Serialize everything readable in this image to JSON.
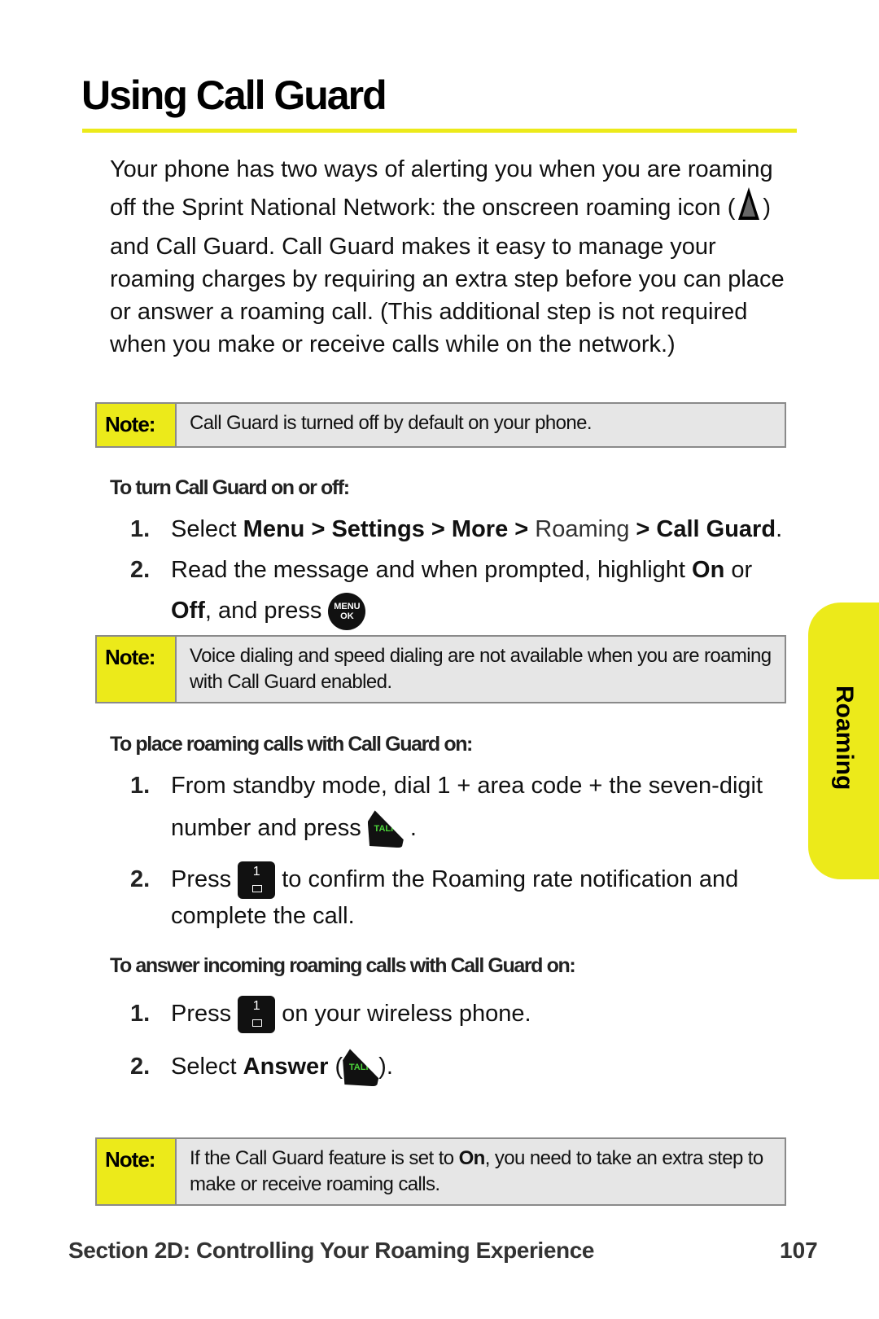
{
  "page": {
    "title": "Using Call Guard",
    "intro": {
      "before_icon": "Your phone has two ways of alerting you when you are roaming off the Sprint National Network: the onscreen roaming icon (",
      "icon": "roaming-icon",
      "after_icon": ") and Call Guard. Call Guard makes it easy to manage your roaming charges by requiring an extra step before you can place or answer a roaming call. (This additional step is not required when you make or receive calls while on the network.)"
    },
    "notes": [
      {
        "label": "Note:",
        "text": "Call Guard is turned off by default on your phone."
      },
      {
        "label": "Note:",
        "text": "Voice dialing and speed dialing are not available when you are roaming with Call Guard enabled."
      },
      {
        "label": "Note:",
        "text_before": "If the Call Guard feature is set to ",
        "bold": "On",
        "text_after": ", you need to take an extra step to make or receive roaming calls."
      }
    ],
    "sections": [
      {
        "heading": "To turn Call Guard on or off:",
        "steps": [
          {
            "num": "1.",
            "parts": [
              "Select ",
              "Menu",
              " > ",
              "Settings",
              " > ",
              "More",
              " > ",
              "Roaming",
              " > ",
              "Call Guard",
              "."
            ]
          },
          {
            "num": "2.",
            "parts": [
              "Read the message and when prompted, highlight ",
              "On",
              " or ",
              "Off",
              ", and press "
            ],
            "key": "MENU OK",
            "key_lines": [
              "MENU",
              "OK"
            ]
          }
        ]
      },
      {
        "heading": "To place roaming calls with Call Guard on:",
        "steps": [
          {
            "num": "1.",
            "parts": [
              "From standby mode, dial 1 + area code + the seven-digit",
              "number and press ",
              "."
            ],
            "key": "TALK"
          },
          {
            "num": "2.",
            "parts": [
              "Press ",
              " to confirm the Roaming rate notification and",
              "complete the call."
            ],
            "key": "1"
          }
        ]
      },
      {
        "heading": "To answer incoming roaming calls with Call Guard on:",
        "steps": [
          {
            "num": "1.",
            "parts": [
              "Press ",
              " on your wireless phone."
            ],
            "key": "1"
          },
          {
            "num": "2.",
            "parts": [
              "Select ",
              "Answer",
              " (",
              ")."
            ],
            "key": "TALK"
          }
        ]
      }
    ],
    "side_tab": "Roaming",
    "footer": {
      "section": "Section 2D: Controlling Your Roaming Experience",
      "page_number": "107"
    },
    "colors": {
      "accent_yellow": "#ecea1a",
      "note_bg": "#e6e6e6",
      "talk_green": "#4cd43a"
    }
  }
}
